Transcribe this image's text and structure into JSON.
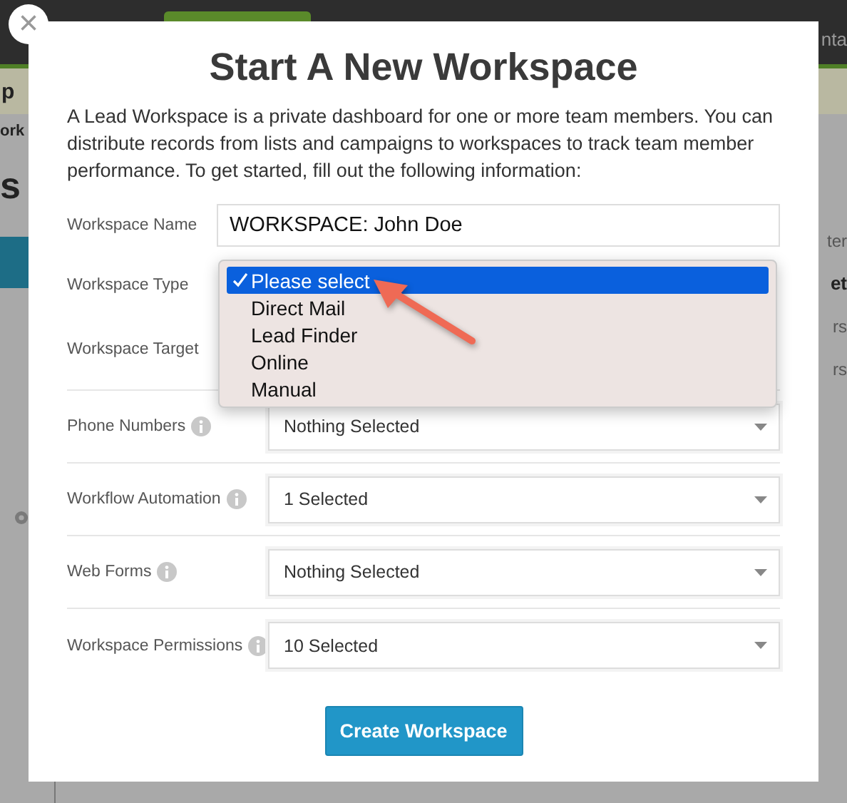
{
  "background": {
    "top_right": "nta",
    "banner": "p",
    "crumb": "ork",
    "heading": "s",
    "right_texts": [
      {
        "text": "ter",
        "kind": "plain"
      },
      {
        "text": "et",
        "kind": "bold"
      },
      {
        "text": "rs",
        "kind": "plain"
      },
      {
        "text": "rs",
        "kind": "plain"
      }
    ]
  },
  "modal": {
    "close": "×",
    "title": "Start A New Workspace",
    "intro": "A Lead Workspace is a private dashboard for one or more team members. You can distribute records from lists and campaigns to workspaces to track team member performance. To get started, fill out the following information:",
    "fields": [
      {
        "label": "Workspace Name",
        "kind": "text",
        "value": "WORKSPACE: John Doe"
      },
      {
        "label": "Workspace Type",
        "kind": "covered"
      },
      {
        "label": "Workspace Target",
        "kind": "covered"
      },
      {
        "label": "Phone Numbers",
        "kind": "select",
        "value": "Nothing Selected"
      },
      {
        "label": "Workflow Automation",
        "kind": "select",
        "value": "1 Selected"
      },
      {
        "label": "Web Forms",
        "kind": "select",
        "value": "Nothing Selected"
      },
      {
        "label": "Workspace Permissions",
        "kind": "select",
        "value": "10 Selected"
      }
    ],
    "dropdown": {
      "options": [
        {
          "label": "Please select",
          "selected": true
        },
        {
          "label": "Direct Mail",
          "selected": false
        },
        {
          "label": "Lead Finder",
          "selected": false
        },
        {
          "label": "Online",
          "selected": false
        },
        {
          "label": "Manual",
          "selected": false
        }
      ]
    },
    "button": "Create Workspace"
  }
}
